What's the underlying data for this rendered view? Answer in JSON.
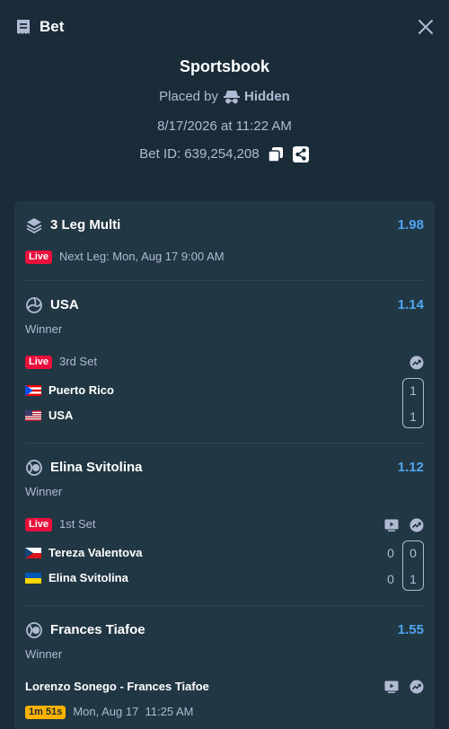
{
  "header": {
    "title": "Bet"
  },
  "bet": {
    "provider": "Sportsbook",
    "placed_by_label": "Placed by",
    "placed_by_name": "Hidden",
    "date": "8/17/2026 at 11:22 AM",
    "bet_id": "Bet ID: 639,254,208"
  },
  "multi": {
    "title": "3 Leg Multi",
    "odds": "1.98",
    "live": "Live",
    "next_leg": "Next Leg: Mon, Aug 17 9:00 AM"
  },
  "legs": [
    {
      "selection": "USA",
      "odds": "1.14",
      "market": "Winner",
      "live": "Live",
      "status": "3rd Set",
      "teams": [
        {
          "name": "Puerto Rico",
          "score": "1"
        },
        {
          "name": "USA",
          "score": "1"
        }
      ]
    },
    {
      "selection": "Elina Svitolina",
      "odds": "1.12",
      "market": "Winner",
      "live": "Live",
      "status": "1st Set",
      "teams": [
        {
          "name": "Tereza Valentova",
          "game": "0",
          "point": "0"
        },
        {
          "name": "Elina Svitolina",
          "game": "0",
          "point": "1"
        }
      ]
    },
    {
      "selection": "Frances Tiafoe",
      "odds": "1.55",
      "market": "Winner",
      "match": "Lorenzo Sonego - Frances Tiafoe",
      "countdown": "1m 51s",
      "start_time": "Mon, Aug 17  11:25 AM"
    }
  ],
  "colors": {
    "background": "#1a2c38",
    "card": "#213743",
    "odds": "#4fa5f0",
    "live": "#e9113c",
    "countdown": "#ffb200"
  },
  "icons": [
    "receipt-icon",
    "close-icon",
    "incognito-icon",
    "copy-icon",
    "share-icon",
    "layers-icon",
    "volleyball-icon",
    "tennis-ball-icon",
    "stats-icon",
    "tv-icon"
  ]
}
